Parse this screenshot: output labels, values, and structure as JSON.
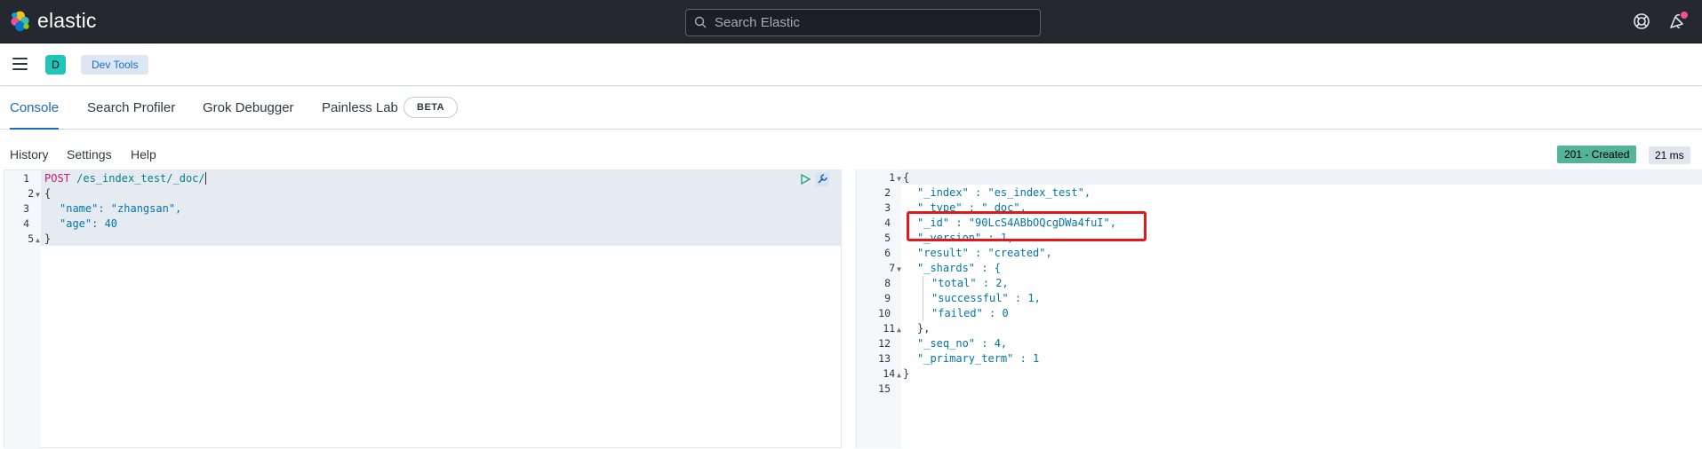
{
  "header": {
    "brand": "elastic",
    "search_placeholder": "Search Elastic"
  },
  "subheader": {
    "space_initial": "D",
    "breadcrumb": "Dev Tools"
  },
  "tabs": [
    {
      "label": "Console",
      "active": true
    },
    {
      "label": "Search Profiler",
      "active": false
    },
    {
      "label": "Grok Debugger",
      "active": false
    },
    {
      "label": "Painless Lab",
      "active": false
    }
  ],
  "beta_badge": "BETA",
  "toolbar": {
    "history": "History",
    "settings": "Settings",
    "help": "Help",
    "status": "201 - Created",
    "elapsed": "21 ms"
  },
  "request": {
    "method": "POST",
    "path": "/es_index_test/_doc/",
    "lines": [
      "{",
      "\"name\": \"zhangsan\",",
      "\"age\": 40",
      "}"
    ]
  },
  "response": {
    "lines": [
      "{",
      "\"_index\" : \"es_index_test\",",
      "\"_type\" : \"_doc\",",
      "\"_id\" : \"90LcS4ABbOQcgDWa4fuI\",",
      "\"_version\" : 1,",
      "\"result\" : \"created\",",
      "\"_shards\" : {",
      "\"total\" : 2,",
      "\"successful\" : 1,",
      "\"failed\" : 0",
      "},",
      "\"_seq_no\" : 4,",
      "\"_primary_term\" : 1",
      "}",
      ""
    ]
  },
  "colors": {
    "header_bg": "#25282f",
    "accent": "#1a6ac0",
    "status_bg": "#54b399",
    "highlight_box": "#e31818"
  }
}
